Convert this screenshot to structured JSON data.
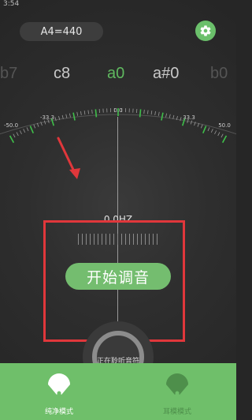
{
  "status_bar": {
    "time": "3:54"
  },
  "header": {
    "pitch_reference": "A4=440"
  },
  "notes": {
    "items": [
      "b7",
      "c8",
      "a0",
      "a#0",
      "b0"
    ],
    "active_index": 2
  },
  "scale": {
    "labels": [
      "-50.0",
      "-33.3",
      "0.0",
      "33.3",
      "50.0"
    ]
  },
  "readout": {
    "frequency": "0.0HZ"
  },
  "main": {
    "start_button_label": "开始调音"
  },
  "dial": {
    "label": "正在聆听音符"
  },
  "bottom_nav": {
    "tabs": [
      {
        "label": "纯净模式",
        "active": true
      },
      {
        "label": "耳模模式",
        "active": false
      }
    ]
  },
  "colors": {
    "accent": "#6fbf6a",
    "highlight": "#e0373b",
    "background": "#262626"
  }
}
